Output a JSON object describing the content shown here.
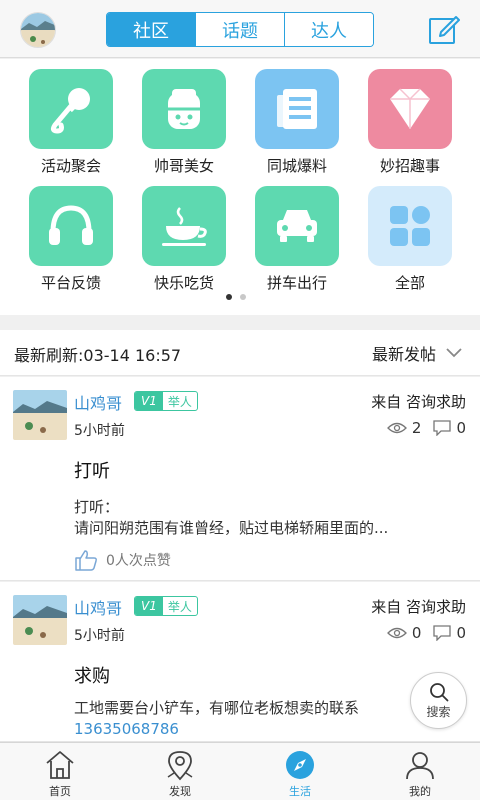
{
  "header": {
    "tabs": [
      {
        "label": "社区",
        "active": true
      },
      {
        "label": "话题",
        "active": false
      },
      {
        "label": "达人",
        "active": false
      }
    ],
    "accent_color": "#2aa2de"
  },
  "categories": [
    {
      "label": "活动聚会",
      "icon": "microphone-icon",
      "color": "#5ed9b0"
    },
    {
      "label": "帅哥美女",
      "icon": "character-icon",
      "color": "#5ed9b0"
    },
    {
      "label": "同城爆料",
      "icon": "newspaper-icon",
      "color": "#7cc4f2"
    },
    {
      "label": "妙招趣事",
      "icon": "diamond-icon",
      "color": "#ee8aa0"
    },
    {
      "label": "平台反馈",
      "icon": "headphones-icon",
      "color": "#5ed9b0"
    },
    {
      "label": "快乐吃货",
      "icon": "coffee-cup-icon",
      "color": "#5ed9b0"
    },
    {
      "label": "拼车出行",
      "icon": "car-icon",
      "color": "#5ed9b0"
    },
    {
      "label": "全部",
      "icon": "grid-icon",
      "color": "#d4ebfb"
    }
  ],
  "pager": {
    "count": 2,
    "active": 0
  },
  "feed": {
    "refresh_label": "最新刷新:03-14 16:57",
    "sort_label": "最新发帖"
  },
  "posts": [
    {
      "user": "山鸡哥",
      "level": "V1",
      "tag": "举人",
      "time": "5小时前",
      "source": "来自 咨询求助",
      "views": "2",
      "comments": "0",
      "title": "打听",
      "body_line1": "打听：",
      "body_line2": "请问阳朔范围有谁曾经，贴过电梯轿厢里面的...",
      "likes": "0人次点赞"
    },
    {
      "user": "山鸡哥",
      "level": "V1",
      "tag": "举人",
      "time": "5小时前",
      "source": "来自 咨询求助",
      "views": "0",
      "comments": "0",
      "title": "求购",
      "body_line1": "工地需要台小铲车，有哪位老板想卖的联系",
      "phone": "13635068786"
    }
  ],
  "float_search": {
    "label": "搜索"
  },
  "bottom_nav": [
    {
      "label": "首页",
      "icon": "home-icon",
      "active": false
    },
    {
      "label": "发现",
      "icon": "location-pin-icon",
      "active": false
    },
    {
      "label": "生活",
      "icon": "compass-icon",
      "active": true
    },
    {
      "label": "我的",
      "icon": "user-icon",
      "active": false
    }
  ]
}
